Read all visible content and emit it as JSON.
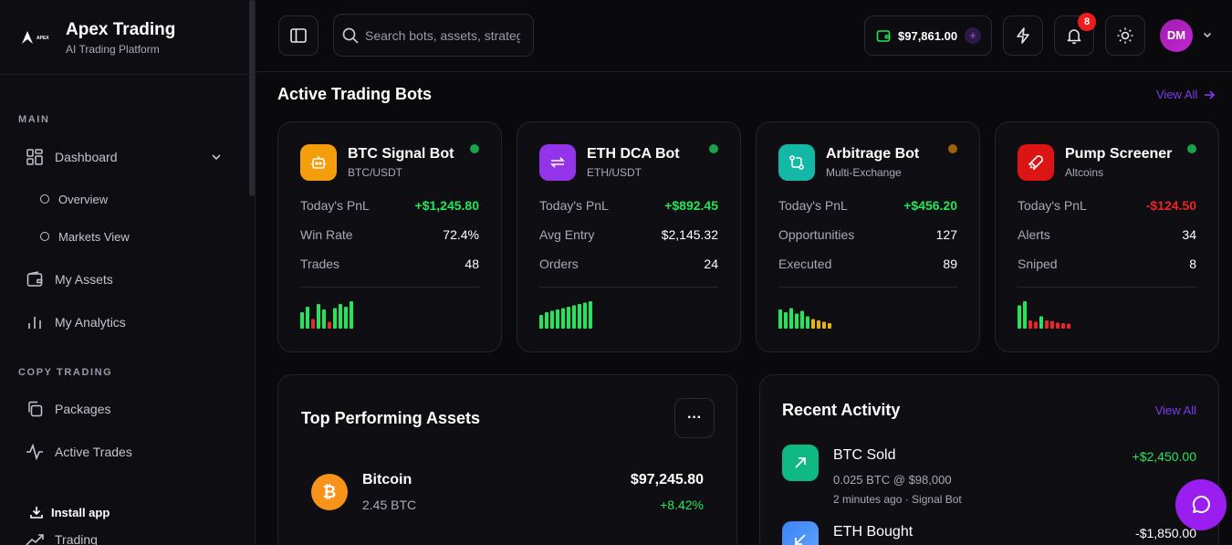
{
  "brand": {
    "title": "Apex Trading",
    "subtitle": "AI Trading Platform",
    "logo_text": "APEX"
  },
  "sidebar": {
    "sections": [
      "MAIN",
      "COPY TRADING"
    ],
    "items": [
      {
        "label": "Dashboard",
        "icon": "dashboard-grid-icon"
      },
      {
        "label": "Overview",
        "icon": "circle-icon"
      },
      {
        "label": "Markets View",
        "icon": "circle-icon"
      },
      {
        "label": "My Assets",
        "icon": "wallet-icon"
      },
      {
        "label": "My Analytics",
        "icon": "bar-chart-icon"
      },
      {
        "label": "Packages",
        "icon": "copy-icon"
      },
      {
        "label": "Active Trades",
        "icon": "activity-icon"
      },
      {
        "label": "Trading",
        "icon": "trending-up-icon"
      }
    ],
    "install_label": "Install app"
  },
  "header": {
    "search_placeholder": "Search bots, assets, strategies...",
    "wallet_balance": "$97,861.00",
    "notification_count": "8",
    "avatar_initials": "DM"
  },
  "bots_section": {
    "title": "Active Trading Bots",
    "view_all": "View All"
  },
  "bots": [
    {
      "name": "BTC Signal Bot",
      "pair": "BTC/USDT",
      "icon": "robot-icon",
      "color": "#f59e0b",
      "status_color": "#16a34a",
      "rows": [
        {
          "label": "Today's PnL",
          "value": "+$1,245.80",
          "tone": "pos"
        },
        {
          "label": "Win Rate",
          "value": "72.4%",
          "tone": ""
        },
        {
          "label": "Trades",
          "value": "48",
          "tone": ""
        }
      ],
      "bars": [
        {
          "v": 0.6,
          "c": "#22e55a"
        },
        {
          "v": 0.8,
          "c": "#22e55a"
        },
        {
          "v": 0.35,
          "c": "#ef2424"
        },
        {
          "v": 0.9,
          "c": "#22e55a"
        },
        {
          "v": 0.7,
          "c": "#22e55a"
        },
        {
          "v": 0.25,
          "c": "#ef2424"
        },
        {
          "v": 0.75,
          "c": "#22e55a"
        },
        {
          "v": 0.9,
          "c": "#22e55a"
        },
        {
          "v": 0.8,
          "c": "#22e55a"
        },
        {
          "v": 1.0,
          "c": "#22e55a"
        }
      ]
    },
    {
      "name": "ETH DCA Bot",
      "pair": "ETH/USDT",
      "icon": "repeat-icon",
      "color": "#9333ea",
      "status_color": "#16a34a",
      "rows": [
        {
          "label": "Today's PnL",
          "value": "+$892.45",
          "tone": "pos"
        },
        {
          "label": "Avg Entry",
          "value": "$2,145.32",
          "tone": ""
        },
        {
          "label": "Orders",
          "value": "24",
          "tone": ""
        }
      ],
      "bars": [
        {
          "v": 0.5,
          "c": "#22e55a"
        },
        {
          "v": 0.6,
          "c": "#22e55a"
        },
        {
          "v": 0.65,
          "c": "#22e55a"
        },
        {
          "v": 0.7,
          "c": "#22e55a"
        },
        {
          "v": 0.75,
          "c": "#22e55a"
        },
        {
          "v": 0.8,
          "c": "#22e55a"
        },
        {
          "v": 0.85,
          "c": "#22e55a"
        },
        {
          "v": 0.9,
          "c": "#22e55a"
        },
        {
          "v": 0.95,
          "c": "#22e55a"
        },
        {
          "v": 1.0,
          "c": "#22e55a"
        }
      ]
    },
    {
      "name": "Arbitrage Bot",
      "pair": "Multi-Exchange",
      "icon": "git-compare-icon",
      "color": "#14b8a6",
      "status_color": "#a16207",
      "rows": [
        {
          "label": "Today's PnL",
          "value": "+$456.20",
          "tone": "pos"
        },
        {
          "label": "Opportunities",
          "value": "127",
          "tone": ""
        },
        {
          "label": "Executed",
          "value": "89",
          "tone": ""
        }
      ],
      "bars": [
        {
          "v": 0.7,
          "c": "#22e55a"
        },
        {
          "v": 0.6,
          "c": "#22e55a"
        },
        {
          "v": 0.75,
          "c": "#22e55a"
        },
        {
          "v": 0.55,
          "c": "#22e55a"
        },
        {
          "v": 0.65,
          "c": "#22e55a"
        },
        {
          "v": 0.45,
          "c": "#22e55a"
        },
        {
          "v": 0.35,
          "c": "#eab308"
        },
        {
          "v": 0.3,
          "c": "#eab308"
        },
        {
          "v": 0.25,
          "c": "#eab308"
        },
        {
          "v": 0.2,
          "c": "#eab308"
        }
      ]
    },
    {
      "name": "Pump Screener",
      "pair": "Altcoins",
      "icon": "rocket-icon",
      "color": "#dc1414",
      "status_color": "#16a34a",
      "rows": [
        {
          "label": "Today's PnL",
          "value": "-$124.50",
          "tone": "neg"
        },
        {
          "label": "Alerts",
          "value": "34",
          "tone": ""
        },
        {
          "label": "Sniped",
          "value": "8",
          "tone": ""
        }
      ],
      "bars": [
        {
          "v": 0.85,
          "c": "#22e55a"
        },
        {
          "v": 1.0,
          "c": "#22e55a"
        },
        {
          "v": 0.3,
          "c": "#ef2424"
        },
        {
          "v": 0.25,
          "c": "#ef2424"
        },
        {
          "v": 0.45,
          "c": "#22e55a"
        },
        {
          "v": 0.3,
          "c": "#ef2424"
        },
        {
          "v": 0.28,
          "c": "#ef2424"
        },
        {
          "v": 0.22,
          "c": "#ef2424"
        },
        {
          "v": 0.2,
          "c": "#ef2424"
        },
        {
          "v": 0.18,
          "c": "#ef2424"
        }
      ]
    }
  ],
  "assets_panel": {
    "title": "Top Performing Assets",
    "more_label": "···",
    "assets": [
      {
        "name": "Bitcoin",
        "qty": "2.45 BTC",
        "price": "$97,245.80",
        "change": "+8.42%",
        "icon": "bitcoin-icon"
      }
    ]
  },
  "activity_panel": {
    "title": "Recent Activity",
    "view_all": "View All",
    "items": [
      {
        "title": "BTC Sold",
        "detail": "0.025 BTC @ $98,000",
        "meta": "2 minutes ago · Signal Bot",
        "amount": "+$2,450.00",
        "tone": "pos",
        "icon": "arrow-up-right-icon"
      },
      {
        "title": "ETH Bought",
        "detail": "",
        "meta": "",
        "amount": "-$1,850.00",
        "tone": "neutral",
        "icon": "arrow-down-left-icon"
      }
    ]
  },
  "colors": {
    "accent": "#7c3aed",
    "positive": "#22e55a",
    "negative": "#ef2424"
  }
}
